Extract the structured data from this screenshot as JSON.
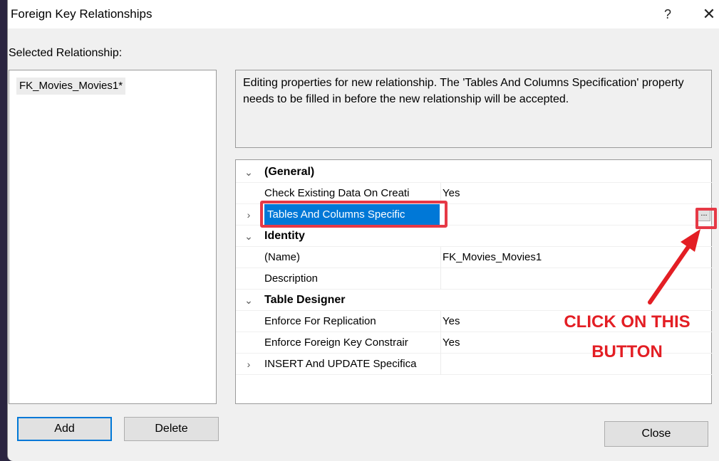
{
  "dialog": {
    "title": "Foreign Key Relationships",
    "help_label": "?",
    "close_glyph": "✕"
  },
  "left": {
    "selected_label": "Selected Relationship:",
    "relationships": [
      "FK_Movies_Movies1*"
    ]
  },
  "info": {
    "text": "Editing properties for new relationship.  The 'Tables And Columns Specification' property needs to be filled in before the new relationship will be accepted."
  },
  "properties": {
    "general": {
      "label": "(General)",
      "check_existing_label": "Check Existing Data On Creati",
      "check_existing_value": "Yes",
      "tables_columns_label": "Tables And Columns Specific",
      "tables_columns_button": "..."
    },
    "identity": {
      "label": "Identity",
      "name_label": "(Name)",
      "name_value": "FK_Movies_Movies1",
      "description_label": "Description",
      "description_value": ""
    },
    "table_designer": {
      "label": "Table Designer",
      "enforce_replication_label": "Enforce For Replication",
      "enforce_replication_value": "Yes",
      "enforce_fk_label": "Enforce Foreign Key Constrair",
      "enforce_fk_value": "Yes",
      "insert_update_label": "INSERT And UPDATE Specifica"
    }
  },
  "annotation": {
    "line1": "CLICK ON THIS",
    "line2": "BUTTON"
  },
  "buttons": {
    "add": "Add",
    "delete": "Delete",
    "close": "Close"
  },
  "colors": {
    "selection_blue": "#0078d7",
    "annotation_red": "#e31e24"
  }
}
